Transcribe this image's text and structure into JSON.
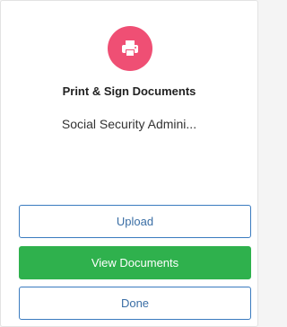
{
  "card": {
    "icon": "printer-icon",
    "icon_bg_color": "#ef4f74",
    "title": "Print & Sign Documents",
    "subtitle": "Social Security Admini..."
  },
  "actions": {
    "upload_label": "Upload",
    "view_label": "View Documents",
    "done_label": "Done"
  },
  "colors": {
    "primary_outline": "#3a7bbf",
    "success": "#2fb14d"
  }
}
